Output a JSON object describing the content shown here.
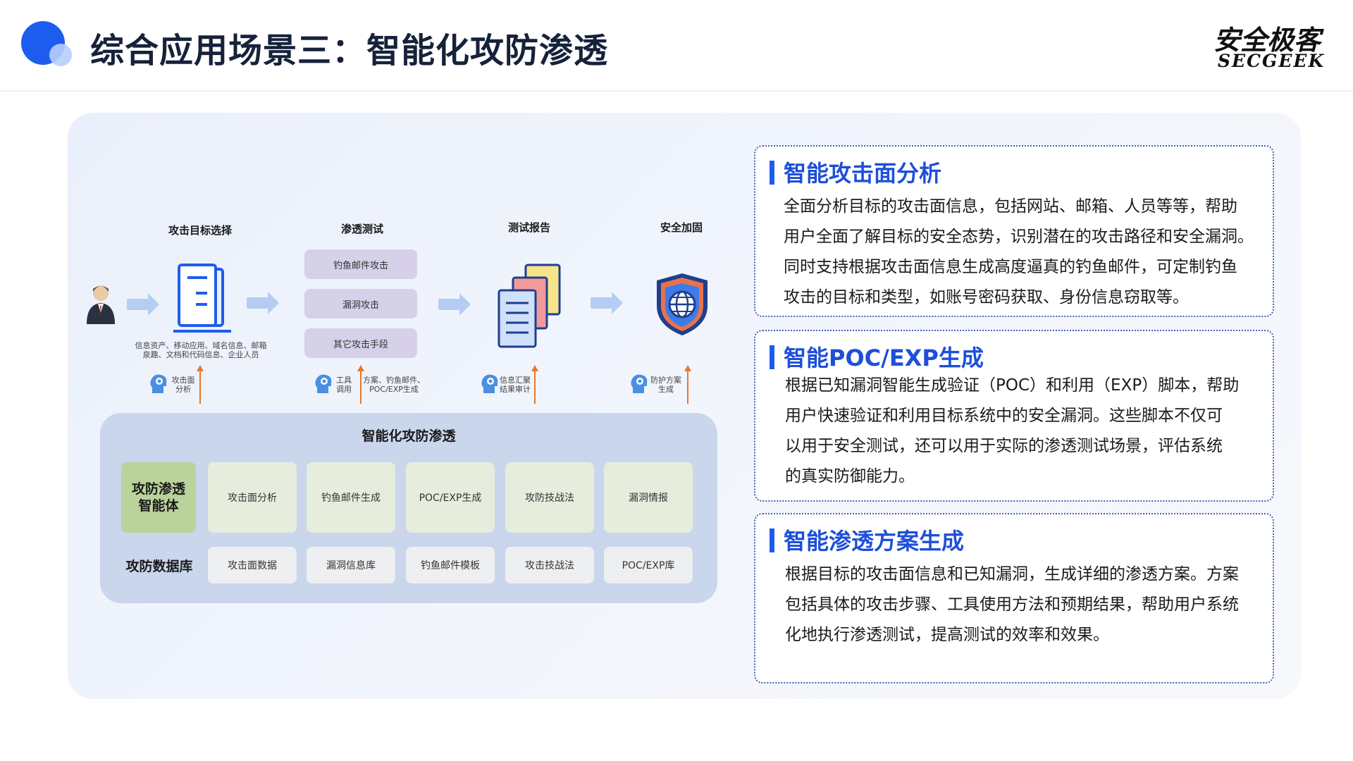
{
  "header": {
    "title": "综合应用场景三：智能化攻防渗透",
    "logo_cn": "安全极客",
    "logo_en": "SECGEEK"
  },
  "diagram": {
    "stages": [
      "攻击目标选择",
      "渗透测试",
      "测试报告",
      "安全加固"
    ],
    "attack_methods": [
      "钓鱼邮件攻击",
      "漏洞攻击",
      "其它攻击手段"
    ],
    "target_info": [
      "信息资产、移动应用、域名信息、邮箱",
      "泉趣、文档和代码信息、企业人员"
    ],
    "support": {
      "s1_label": [
        "攻击面",
        "分析"
      ],
      "s2_label": [
        "工具",
        "调用"
      ],
      "s2_extra": [
        "方案、钓鱼邮件、",
        "POC/EXP生成"
      ],
      "s3_label": [
        "信息汇聚",
        "结果审计"
      ],
      "s4_label": [
        "防护方案",
        "生成"
      ]
    },
    "platform": {
      "title": "智能化攻防渗透",
      "row1_key": [
        "攻防渗透",
        "智能体"
      ],
      "row1_items": [
        "攻击面分析",
        "钓鱼邮件生成",
        "POC/EXP生成",
        "攻防技战法",
        "漏洞情报"
      ],
      "row2_key": "攻防数据库",
      "row2_items": [
        "攻击面数据",
        "漏洞信息库",
        "钓鱼邮件模板",
        "攻击技战法",
        "POC/EXP库"
      ]
    }
  },
  "cards": [
    {
      "title": "智能攻击面分析",
      "lines": [
        "全面分析目标的攻击面信息，包括网站、邮箱、人员等等，帮助",
        "用户全面了解目标的安全态势，识别潜在的攻击路径和安全漏洞。",
        "同时支持根据攻击面信息生成高度逼真的钓鱼邮件，可定制钓鱼",
        "攻击的目标和类型，如账号密码获取、身份信息窃取等。"
      ]
    },
    {
      "title": "智能POC/EXP生成",
      "lines": [
        "根据已知漏洞智能生成验证（POC）和利用（EXP）脚本，帮助",
        "用户快速验证和利用目标系统中的安全漏洞。这些脚本不仅可",
        "以用于安全测试，还可以用于实际的渗透测试场景，评估系统",
        "的真实防御能力。"
      ]
    },
    {
      "title": "智能渗透方案生成",
      "lines": [
        "根据目标的攻击面信息和已知漏洞，生成详细的渗透方案。方案",
        "包括具体的攻击步骤、工具使用方法和预期结果，帮助用户系统",
        "化地执行渗透测试，提高测试的效率和效果。"
      ]
    }
  ],
  "colors": {
    "accent": "#1e5cf0",
    "card_border": "#3f63b5",
    "support_arrow": "#e6772e",
    "flow_arrow": "#b5cdf2"
  }
}
